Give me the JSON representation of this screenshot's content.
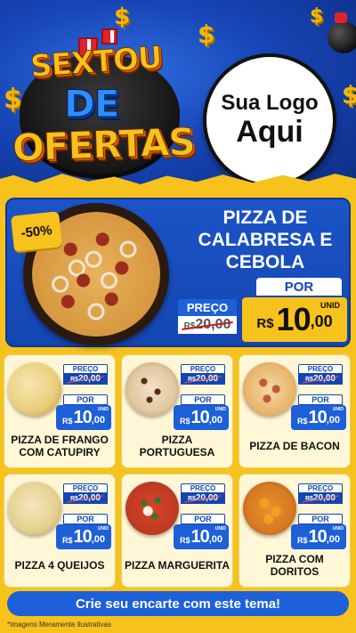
{
  "header": {
    "promo_line1": "SEXTOU",
    "promo_line2": "DE",
    "promo_line3": "OFERTAS",
    "logo_line1": "Sua Logo",
    "logo_line2": "Aqui",
    "dollar_symbol": "$"
  },
  "featured": {
    "discount": "-50%",
    "title": "PIZZA DE CALABRESA E CEBOLA",
    "old_label": "PREÇO",
    "old_currency": "R$",
    "old_price": "20,00",
    "new_label": "POR",
    "new_currency": "R$",
    "new_int": "10",
    "new_dec": ",00",
    "unit": "UNID"
  },
  "products": [
    {
      "name": "PIZZA DE FRANGO COM CATUPIRY",
      "old_label": "PREÇO",
      "old_currency": "R$",
      "old_price": "20,00",
      "new_label": "POR",
      "new_currency": "R$",
      "new_int": "10",
      "new_dec": ",00",
      "unit": "UNID"
    },
    {
      "name": "PIZZA PORTUGUESA",
      "old_label": "PREÇO",
      "old_currency": "R$",
      "old_price": "20,00",
      "new_label": "POR",
      "new_currency": "R$",
      "new_int": "10",
      "new_dec": ",00",
      "unit": "UNID"
    },
    {
      "name": "PIZZA DE BACON",
      "old_label": "PREÇO",
      "old_currency": "R$",
      "old_price": "20,00",
      "new_label": "POR",
      "new_currency": "R$",
      "new_int": "10",
      "new_dec": ",00",
      "unit": "UNID"
    },
    {
      "name": "PIZZA 4 QUEIJOS",
      "old_label": "PREÇO",
      "old_currency": "R$",
      "old_price": "20,00",
      "new_label": "POR",
      "new_currency": "R$",
      "new_int": "10",
      "new_dec": ",00",
      "unit": "UNID"
    },
    {
      "name": "PIZZA MARGUERITA",
      "old_label": "PREÇO",
      "old_currency": "R$",
      "old_price": "20,00",
      "new_label": "POR",
      "new_currency": "R$",
      "new_int": "10",
      "new_dec": ",00",
      "unit": "UNID"
    },
    {
      "name": "PIZZA COM DORITOS",
      "old_label": "PREÇO",
      "old_currency": "R$",
      "old_price": "20,00",
      "new_label": "POR",
      "new_currency": "R$",
      "new_int": "10",
      "new_dec": ",00",
      "unit": "UNID"
    }
  ],
  "footer": {
    "cta": "Crie seu encarte com este tema!",
    "disclaimer": "*Imagens Meramente Ilustrativas"
  },
  "colors": {
    "brand_blue": "#1446b2",
    "accent_yellow": "#f7c21b",
    "strike_red": "#d01818"
  },
  "icons": [
    "dollar-sign-icon",
    "gift-box-icon",
    "bomb-icon"
  ]
}
